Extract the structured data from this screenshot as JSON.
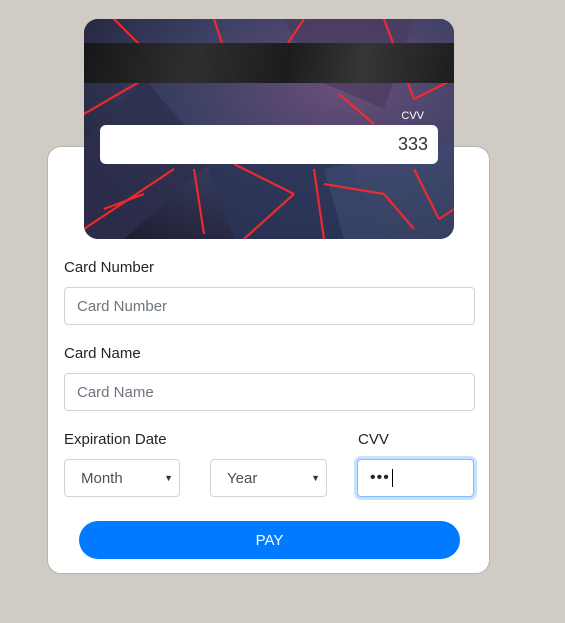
{
  "card_preview": {
    "cvv_caption": "CVV",
    "cvv_value": "333"
  },
  "form": {
    "card_number": {
      "label": "Card Number",
      "placeholder": "Card Number"
    },
    "card_name": {
      "label": "Card Name",
      "placeholder": "Card Name"
    },
    "expiration": {
      "label": "Expiration Date",
      "month_selected": "Month",
      "year_selected": "Year"
    },
    "cvv": {
      "label": "CVV",
      "masked_value": "•••"
    },
    "pay_label": "PAY"
  },
  "colors": {
    "page_background": "#d0cbc4",
    "accent": "#007bff",
    "card_glow": "#ff2a2a"
  },
  "icons": {
    "select_caret": "chevron-down-icon"
  }
}
